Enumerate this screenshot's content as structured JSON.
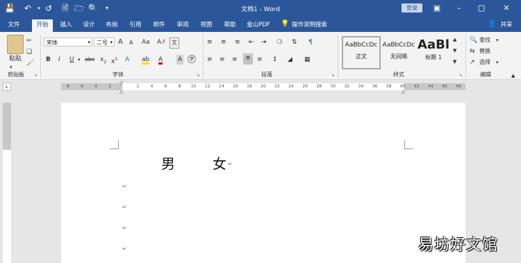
{
  "app": {
    "window_title": "文档1 - Word",
    "login_label": "登录",
    "share_label": "共享",
    "tell_me": "操作说明搜索"
  },
  "tabs": [
    "文件",
    "开始",
    "插入",
    "设计",
    "布局",
    "引用",
    "邮件",
    "审阅",
    "视图",
    "帮助",
    "金山PDF"
  ],
  "active_tab": "开始",
  "ribbon": {
    "clipboard": {
      "label": "剪贴板",
      "paste": "粘贴"
    },
    "font": {
      "label": "字体",
      "font_name": "宋体",
      "font_size": "二号",
      "grow": "A",
      "shrink": "A",
      "case": "Aa",
      "clear": "A",
      "bold": "B",
      "italic": "I",
      "underline": "U",
      "strike": "abc",
      "sub": "x",
      "sup": "x",
      "effects": "A",
      "highlight": "ab",
      "font_color": "A",
      "shade": "A"
    },
    "paragraph": {
      "label": "段落"
    },
    "styles": {
      "label": "样式",
      "items": [
        {
          "sample": "AaBbCcDc",
          "name": "正文"
        },
        {
          "sample": "AaBbCcDc",
          "name": "无间隔"
        },
        {
          "sample": "AaBl",
          "name": "标题 1"
        }
      ]
    },
    "editing": {
      "label": "编辑",
      "find": "查找",
      "replace": "替换",
      "select": "选择"
    }
  },
  "ruler": {
    "corner": "L",
    "labels": [
      "8",
      "6",
      "4",
      "2",
      "",
      "2",
      "4",
      "6",
      "8",
      "10",
      "12",
      "14",
      "16",
      "18",
      "20",
      "22",
      "24",
      "26",
      "28",
      "30",
      "32",
      "34",
      "36",
      "38",
      "40",
      "42",
      "44",
      "46",
      "48"
    ]
  },
  "document": {
    "line1_char1": "男",
    "line1_char2": "女",
    "para_mark": "↵"
  },
  "watermark": "易坊好文馆"
}
